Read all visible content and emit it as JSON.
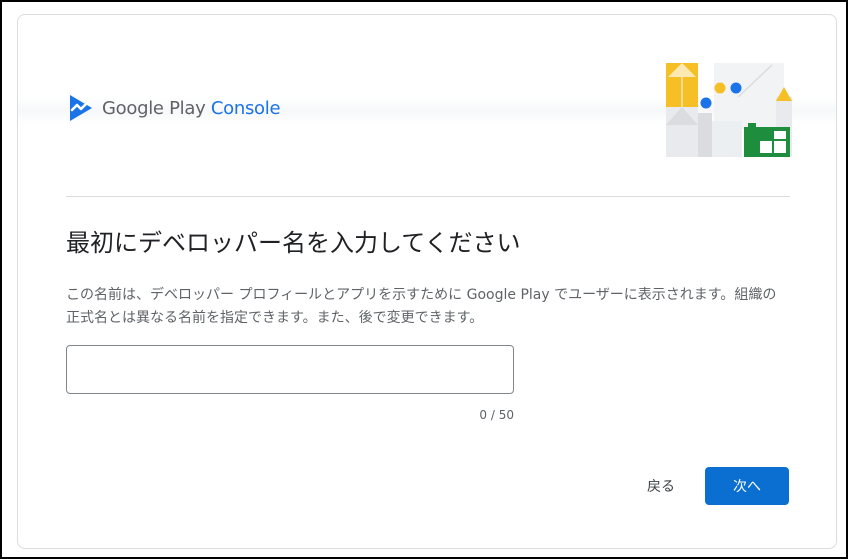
{
  "colors": {
    "brand_blue": "#1a73e8",
    "primary_button": "#0b6fd1",
    "logo_gray": "#5f6368",
    "illustration_yellow": "#f6bf26",
    "illustration_green": "#1e8e3e"
  },
  "header": {
    "logo_icon": "play-console-logo-icon",
    "logo_text_prefix": "Google Play ",
    "logo_text_accent": "Console",
    "illustration": "decorative-shapes-illustration"
  },
  "main": {
    "title": "最初にデベロッパー名を入力してください",
    "description": "この名前は、デベロッパー プロフィールとアプリを示すために Google Play でユーザーに表示されます。組織の正式名とは異なる名前を指定できます。また、後で変更できます。",
    "name_input": {
      "value": "",
      "placeholder": ""
    },
    "char_counter": "0 / 50"
  },
  "footer": {
    "back_label": "戻る",
    "next_label": "次へ"
  }
}
